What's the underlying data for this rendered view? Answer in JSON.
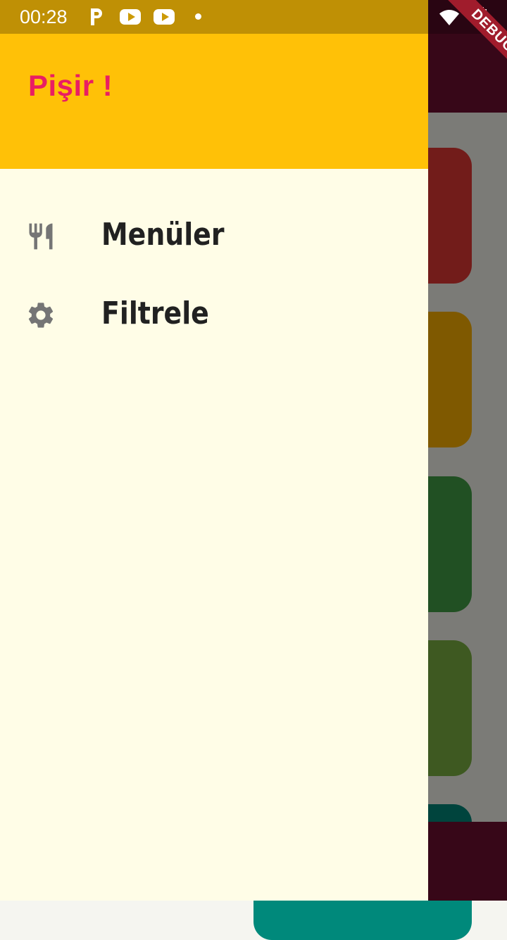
{
  "status_bar": {
    "time": "00:28"
  },
  "drawer": {
    "title": "Pişir !",
    "items": [
      {
        "label": "Menüler",
        "icon": "restaurant-icon"
      },
      {
        "label": "Filtrele",
        "icon": "settings-icon"
      }
    ]
  },
  "debug_banner": "DEBUG",
  "colors": {
    "drawer_header": "#ffc107",
    "drawer_background": "#fffde7",
    "title": "#e91e63",
    "app_bar": "#6f0e30",
    "card_colors": [
      "#e53935",
      "#ffb300",
      "#43a047",
      "#7cb342",
      "#00897b"
    ]
  }
}
